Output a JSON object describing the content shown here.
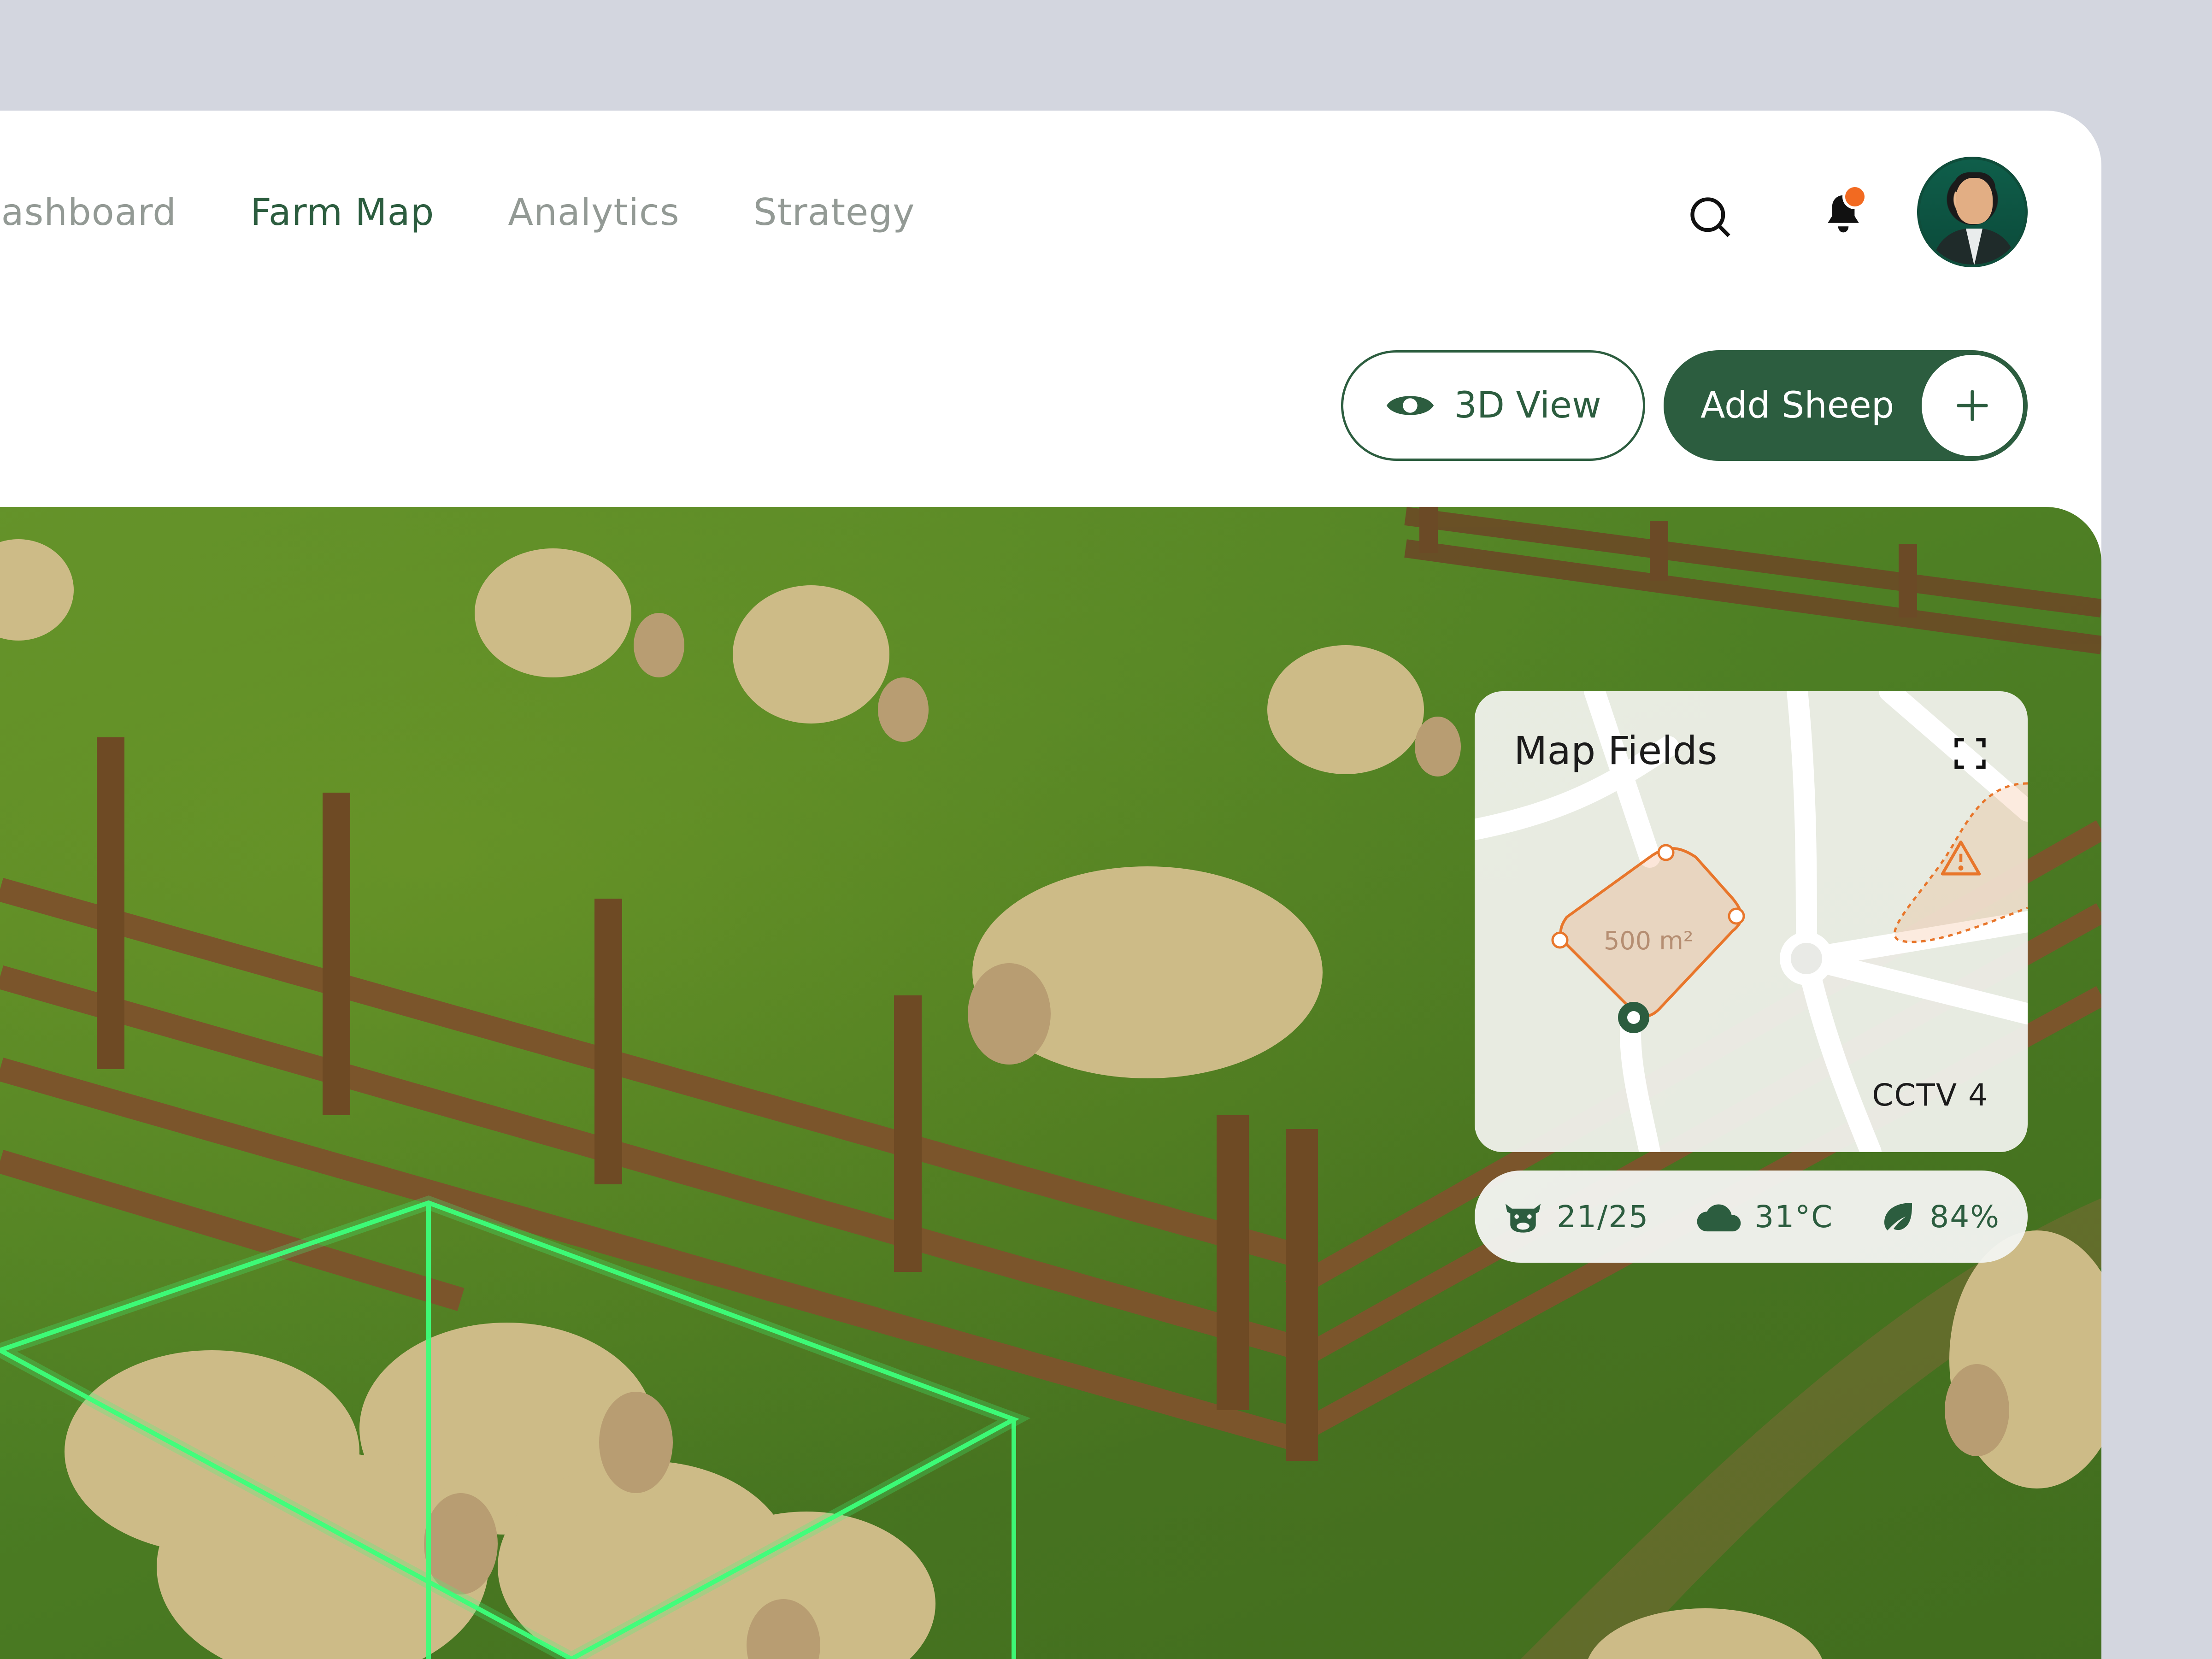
{
  "nav": {
    "items": [
      {
        "label": "Dashboard",
        "active": false
      },
      {
        "label": "Farm Map",
        "active": true
      },
      {
        "label": "Analytics",
        "active": false
      },
      {
        "label": "Strategy",
        "active": false
      }
    ]
  },
  "header": {
    "search_icon": "search-icon",
    "notification_icon": "bell-icon",
    "notification_dot_color": "#f26a21",
    "avatar_alt": "user-avatar"
  },
  "actions": {
    "view_3d_label": "3D View",
    "add_sheep_label": "Add Sheep"
  },
  "map_fields": {
    "title": "Map Fields",
    "area_label": "500 m²",
    "camera_label": "CCTV 4",
    "expand_icon": "expand-icon",
    "alert_icon": "warning-icon",
    "highlight_color": "#e8762b"
  },
  "stats": {
    "herd": "21/25",
    "temperature": "31°C",
    "vegetation": "84%"
  },
  "colors": {
    "brand_green": "#2c5d3f",
    "accent_orange": "#e8762b",
    "selection_glow": "#3dff7a"
  }
}
